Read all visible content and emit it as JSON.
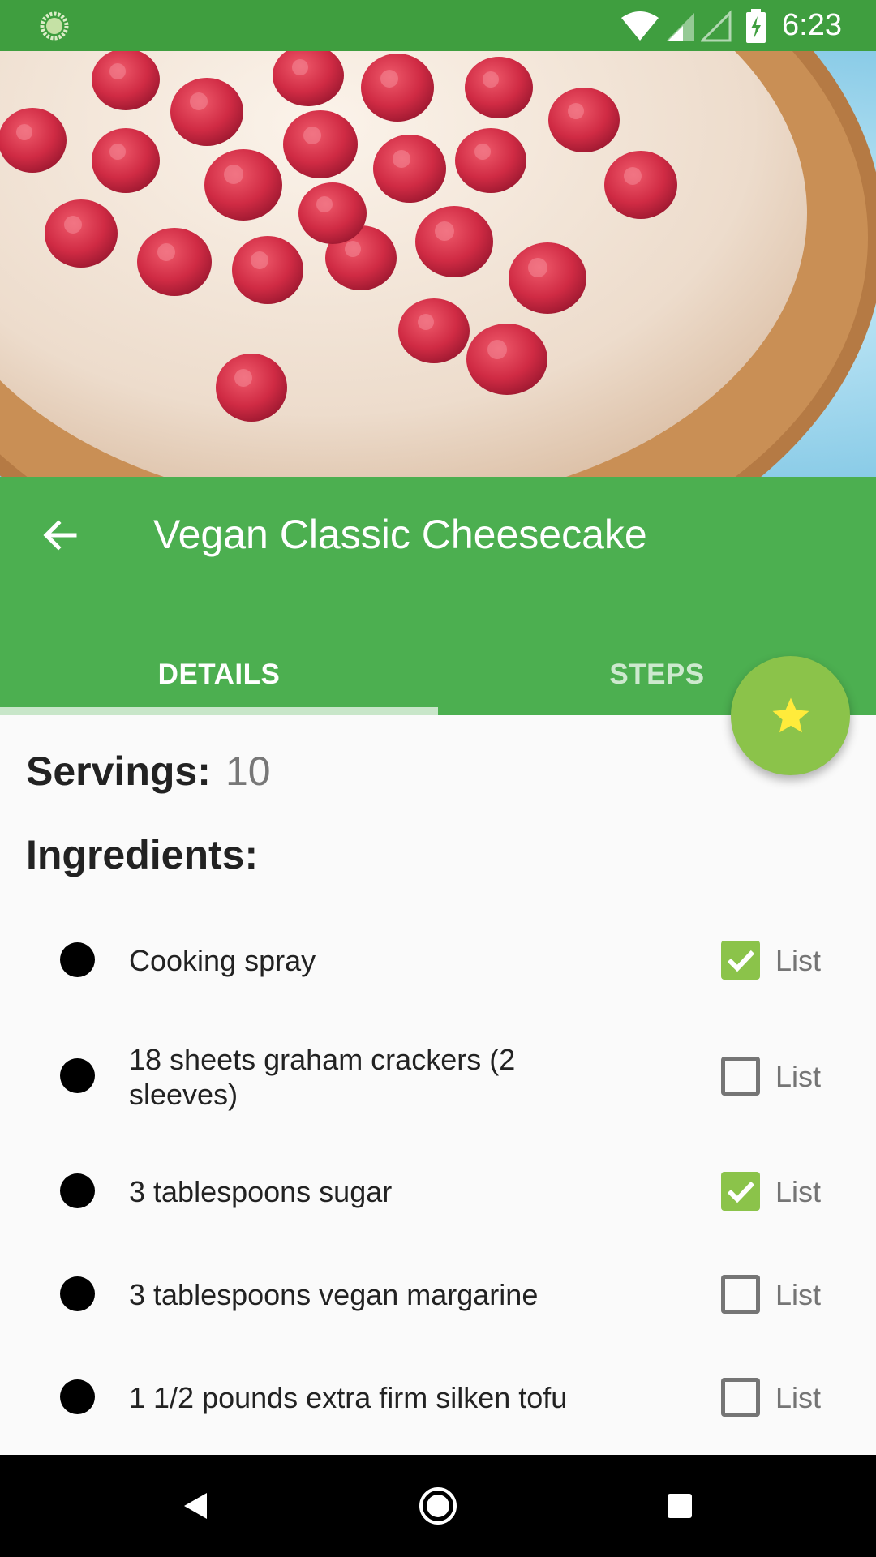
{
  "status_bar": {
    "time": "6:23",
    "icons": [
      "notification-icon",
      "wifi-icon",
      "signal-icon",
      "signal-empty-icon",
      "battery-charging-icon"
    ],
    "background": "#3f9e3f"
  },
  "hero": {
    "description_icon": "cheesecake-photo"
  },
  "app_bar": {
    "title": "Vegan Classic Cheesecake",
    "back_icon": "arrow-back-icon",
    "color": "#4caf50"
  },
  "tabs": [
    {
      "label": "DETAILS",
      "selected": true
    },
    {
      "label": "STEPS",
      "selected": false
    }
  ],
  "fab": {
    "icon": "star-icon",
    "color": "#8bc34a",
    "icon_color": "#ffeb3b"
  },
  "servings": {
    "label": "Servings:",
    "value": "10"
  },
  "ingredients_heading": "Ingredients:",
  "ingredients": [
    {
      "text": "Cooking spray",
      "checked": true,
      "list_label": "List"
    },
    {
      "text": "18 sheets graham crackers (2 sleeves)",
      "checked": false,
      "list_label": "List"
    },
    {
      "text": "3 tablespoons sugar",
      "checked": true,
      "list_label": "List"
    },
    {
      "text": "3 tablespoons vegan margarine",
      "checked": false,
      "list_label": "List"
    },
    {
      "text": "1 1/2 pounds extra firm silken tofu",
      "checked": false,
      "list_label": "List"
    }
  ],
  "nav_bar": {
    "icons": [
      "back-triangle-icon",
      "home-circle-icon",
      "recents-square-icon"
    ]
  }
}
